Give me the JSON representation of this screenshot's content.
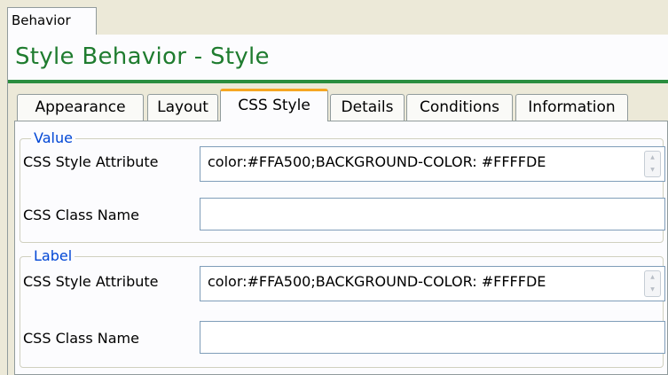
{
  "window": {
    "top_tab": "Behavior",
    "title": "Style Behavior - Style"
  },
  "tabs": [
    {
      "label": "Appearance",
      "active": false
    },
    {
      "label": "Layout",
      "active": false
    },
    {
      "label": "CSS Style",
      "active": true
    },
    {
      "label": "Details",
      "active": false
    },
    {
      "label": "Conditions",
      "active": false
    },
    {
      "label": "Information",
      "active": false
    }
  ],
  "groups": {
    "value": {
      "legend": "Value",
      "style_label": "CSS Style Attribute",
      "style_value": "color:#FFA500;BACKGROUND-COLOR: #FFFFDE",
      "class_label": "CSS Class Name",
      "class_value": ""
    },
    "label": {
      "legend": "Label",
      "style_label": "CSS Style Attribute",
      "style_value": "color:#FFA500;BACKGROUND-COLOR: #FFFFDE",
      "class_label": "CSS Class Name",
      "class_value": ""
    }
  },
  "icons": {
    "spin_up": "chevron-up-icon",
    "spin_down": "chevron-down-icon"
  },
  "colors": {
    "title_green": "#1f7c2f",
    "legend_blue": "#0046d5",
    "active_tab_accent": "#f5a623",
    "panel_background": "#ece9d8"
  }
}
